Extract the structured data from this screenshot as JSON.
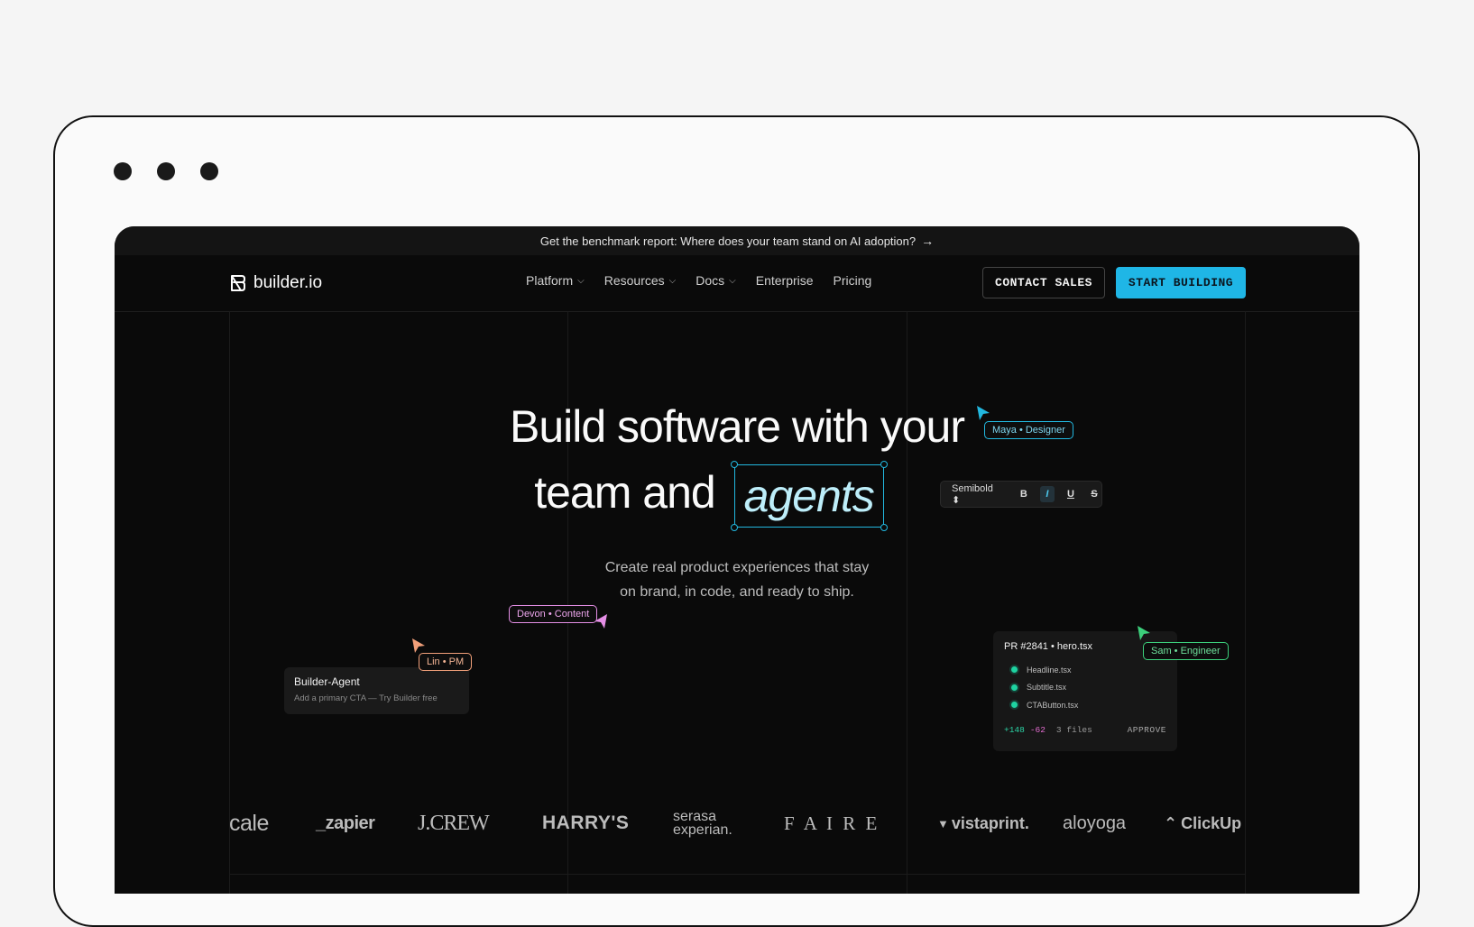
{
  "banner": {
    "text": "Get the benchmark report: Where does your team stand on AI adoption?",
    "arrow": "→"
  },
  "nav": {
    "logo": "builder.io",
    "items": [
      {
        "label": "Platform",
        "dropdown": true
      },
      {
        "label": "Resources",
        "dropdown": true
      },
      {
        "label": "Docs",
        "dropdown": true
      },
      {
        "label": "Enterprise",
        "dropdown": false
      },
      {
        "label": "Pricing",
        "dropdown": false
      }
    ],
    "contact_label": "CONTACT SALES",
    "start_label": "START BUILDING"
  },
  "hero": {
    "line1": "Build software with your",
    "line2_prefix": "team and",
    "highlight": "agents",
    "subtitle_line1": "Create real product experiences that stay",
    "subtitle_line2": "on brand, in code, and ready to ship."
  },
  "toolbar": {
    "font_weight": "Semibold",
    "bold": "B",
    "italic": "I",
    "underline": "U",
    "strike": "S"
  },
  "collaborators": {
    "maya": "Maya • Designer",
    "devon": "Devon • Content",
    "lin": "Lin • PM",
    "sam": "Sam • Engineer"
  },
  "agent_card": {
    "title": "Builder-Agent",
    "message": "Add a primary CTA — Try Builder free"
  },
  "pr_card": {
    "title": "PR #2841 • hero.tsx",
    "files": [
      "Headline.tsx",
      "Subtitle.tsx",
      "CTAButton.tsx"
    ],
    "additions": "+148",
    "deletions": "-62",
    "file_count": "3 files",
    "approve_label": "APPROVE"
  },
  "logos": [
    "cale",
    "_zapier",
    "J.CREW",
    "HARRY'S",
    "serasa experian.",
    "F A I R E",
    "vistaprint.",
    "aloyoga",
    "ClickUp"
  ],
  "colors": {
    "accent": "#1fb6e6",
    "maya": "#22b8e0",
    "devon": "#e58fe6",
    "lin": "#f2a07a",
    "sam": "#3ccf7b"
  }
}
